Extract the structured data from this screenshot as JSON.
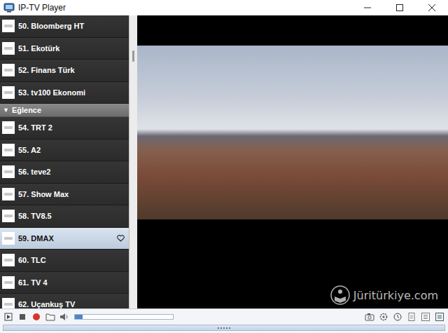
{
  "window": {
    "title": "IP-TV Player"
  },
  "channel_list": [
    {
      "kind": "channel",
      "label": "50. Bloomberg HT",
      "selected": false
    },
    {
      "kind": "channel",
      "label": "51. Ekotürk",
      "selected": false
    },
    {
      "kind": "channel",
      "label": "52. Finans Türk",
      "selected": false
    },
    {
      "kind": "channel",
      "label": "53. tv100 Ekonomi",
      "selected": false
    },
    {
      "kind": "group",
      "label": "Eğlence",
      "arrow": "▼",
      "expanded": true
    },
    {
      "kind": "channel",
      "label": "54. TRT 2",
      "selected": false
    },
    {
      "kind": "channel",
      "label": "55. A2",
      "selected": false
    },
    {
      "kind": "channel",
      "label": "56. teve2",
      "selected": false
    },
    {
      "kind": "channel",
      "label": "57. Show Max",
      "selected": false
    },
    {
      "kind": "channel",
      "label": "58. TV8.5",
      "selected": false
    },
    {
      "kind": "channel",
      "label": "59. DMAX",
      "selected": true
    },
    {
      "kind": "channel",
      "label": "60. TLC",
      "selected": false
    },
    {
      "kind": "channel",
      "label": "61. TV 4",
      "selected": false
    },
    {
      "kind": "channel",
      "label": "62. Uçankuş TV",
      "selected": false
    }
  ],
  "player": {
    "volume": {
      "level": 0.08
    }
  },
  "watermark": "Jüritürkiye.com"
}
